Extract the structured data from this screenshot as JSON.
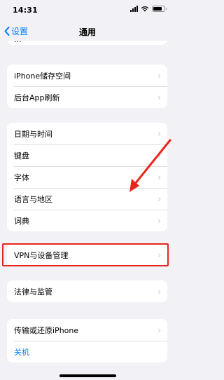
{
  "status_bar": {
    "time": "14:31"
  },
  "nav": {
    "back_label": "设置",
    "title": "通用"
  },
  "cut_row": {
    "label": "..."
  },
  "groups": [
    {
      "rows": [
        {
          "label": "iPhone储存空间"
        },
        {
          "label": "后台App刷新"
        }
      ]
    },
    {
      "rows": [
        {
          "label": "日期与时间"
        },
        {
          "label": "键盘"
        },
        {
          "label": "字体"
        },
        {
          "label": "语言与地区"
        },
        {
          "label": "词典"
        }
      ]
    },
    {
      "rows": [
        {
          "label": "VPN与设备管理"
        }
      ]
    },
    {
      "rows": [
        {
          "label": "法律与监管"
        }
      ]
    },
    {
      "rows": [
        {
          "label": "传输或还原iPhone"
        },
        {
          "label": "关机"
        }
      ]
    }
  ],
  "colors": {
    "accent": "#007aff",
    "annotation": "#e8261b",
    "background": "#f2f2f6"
  },
  "icons": {
    "back": "chevron-left-icon",
    "row": "chevron-right-icon",
    "wifi": "wifi-icon",
    "battery": "battery-icon",
    "signal": "signal-icon"
  }
}
